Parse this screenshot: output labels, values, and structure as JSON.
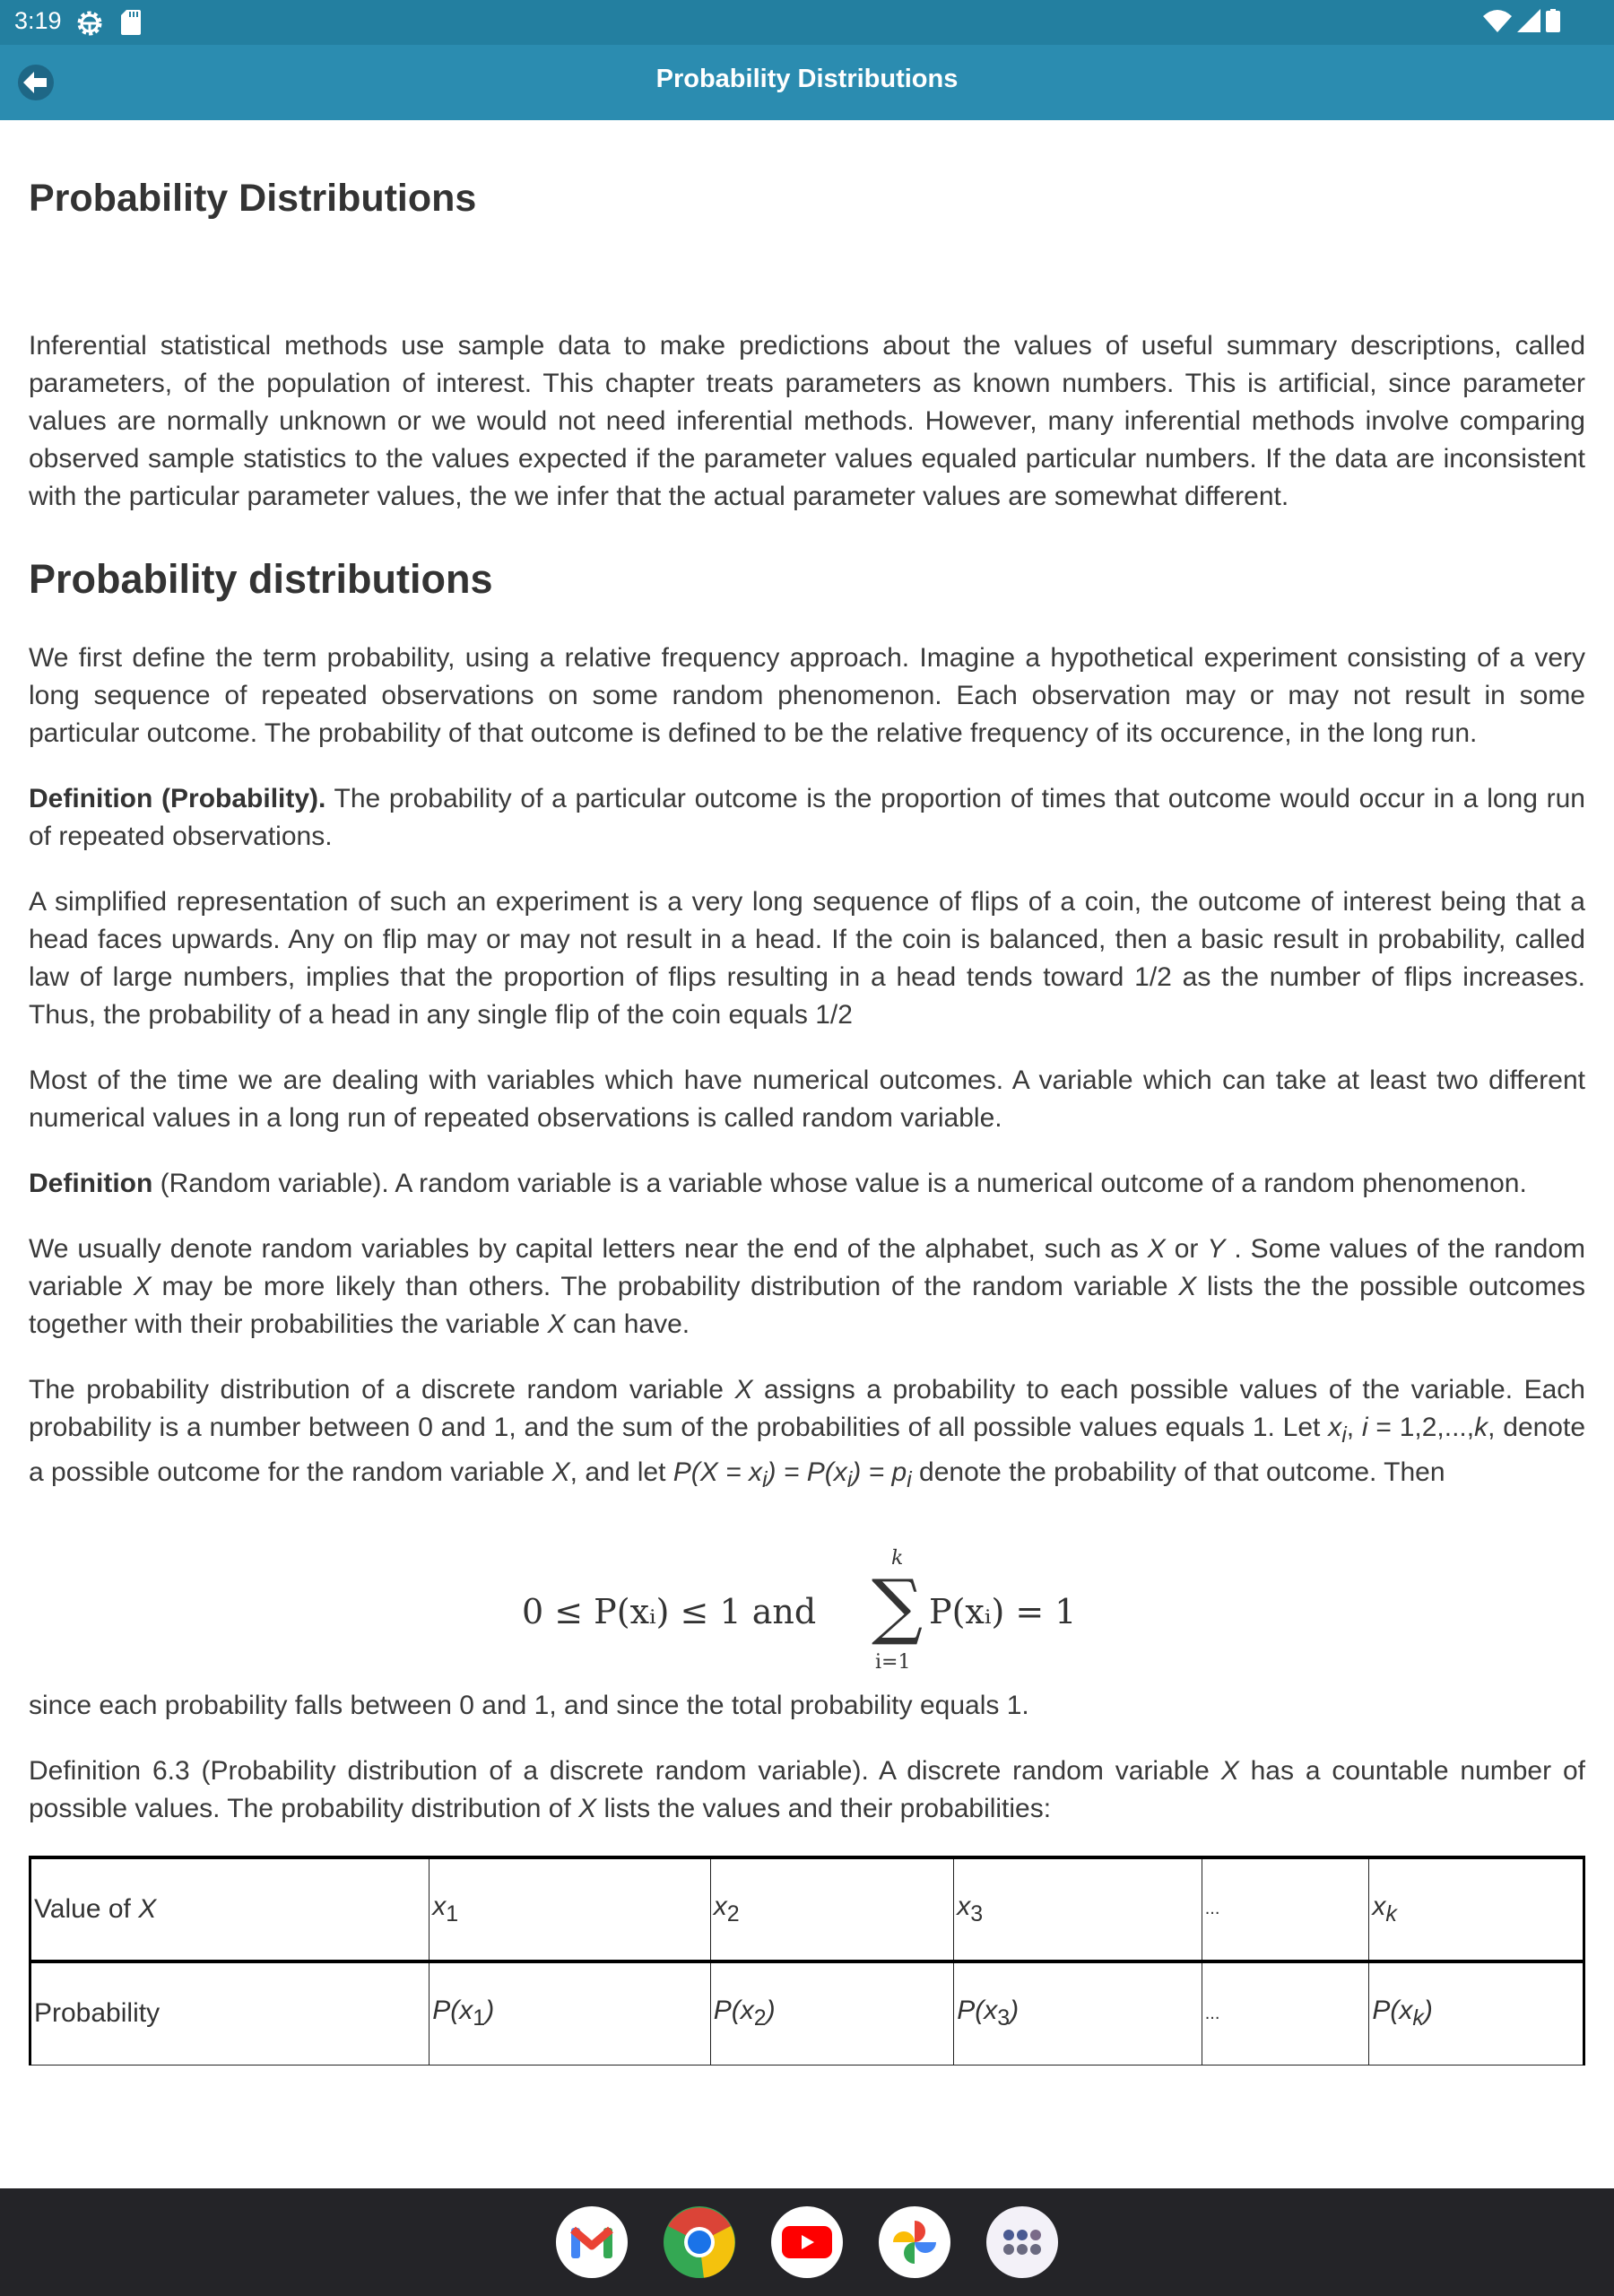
{
  "status_bar": {
    "time": "3:19",
    "icons": [
      "settings-gear-icon",
      "sd-card-icon",
      "wifi-icon",
      "cellular-signal-icon",
      "battery-icon"
    ]
  },
  "app_bar": {
    "title": "Probability Distributions",
    "back_icon": "arrow-left-icon"
  },
  "article": {
    "page_title": "Probability Distributions",
    "intro": "Inferential statistical methods use sample data to make predictions about the values of useful summary descriptions, called parameters, of the population of interest. This chapter treats parameters as known numbers. This is artificial, since parameter values are normally unknown or we would not need inferential methods. However, many inferential methods involve comparing observed sample statistics to the values expected if the parameter values equaled particular numbers. If the data are inconsistent with the particular parameter values, the we infer that the actual parameter values are somewhat different.",
    "section_title": "Probability distributions",
    "p1": "We first define the term probability, using a relative frequency approach. Imagine a hypothetical experiment consisting of a very long sequence of repeated observations on some random phenomenon. Each observation may or may not result in some particular outcome. The probability of that outcome is defined to be the relative frequency of its occurence, in the long run.",
    "def1_bold": "Definition  (Probability).",
    "def1_text": " The probability of a particular outcome is the proportion of times that outcome would occur in a long run of repeated observations.",
    "p2": "A simplified representation of such an experiment is a very long sequence of flips of a coin, the outcome of interest being that a head faces upwards. Any on flip may or may not result in a head. If the coin is balanced, then a basic result in probability, called law of large numbers, implies that the proportion of flips resulting in a head tends toward 1/2 as the number of flips increases. Thus, the probability of a head in any single flip of the coin equals 1/2",
    "p3": "Most of the time we are dealing with variables which have numerical outcomes. A variable which can take at least two different numerical values in a long run of repeated observations is called random variable.",
    "def2_bold": "Definition",
    "def2_text": " (Random variable). A random variable is a variable whose value is a numerical outcome of a random phenomenon.",
    "p4_a": "We usually denote random variables by capital letters near the end of the alphabet, such as ",
    "p4_X": "X",
    "p4_b": " or ",
    "p4_Y": "Y",
    "p4_c": " . Some values of the random variable ",
    "p4_d": " may be more likely than others. The probability distribution of the random variable ",
    "p4_e": " lists the the possible outcomes together with their probabilities the variable ",
    "p4_f": " can have.",
    "p5_a": "The probability distribution of a discrete random variable ",
    "p5_b": " assigns a probability to each possible values of the variable. Each probability is a number between 0 and 1, and the sum of the probabilities of all possible values equals 1. Let ",
    "p5_xi": "x",
    "p5_i": "i",
    "p5_c": ", ",
    "p5_d": " = 1,2,...,",
    "p5_k": "k",
    "p5_e": ", denote a possible outcome for the random variable ",
    "p5_f": ", and let ",
    "p5_eq": "P(X = x",
    "p5_g": ") = P(x",
    "p5_h": ") = p",
    "p5_j": " denote the probability of that outcome. Then",
    "formula": {
      "lhs": "0 ≤ P(xᵢ) ≤ 1   and",
      "sigma": "∑",
      "upper": "k",
      "lower": "i=1",
      "rhs": "P(xᵢ) = 1"
    },
    "p6": "since each probability falls between 0 and 1, and since the total probability equals 1.",
    "p7_a": "Definition 6.3 (Probability distribution of a discrete random variable). A discrete random variable ",
    "p7_b": " has a countable number of possible values. The probability distribution of ",
    "p7_c": " lists the values and their probabilities:",
    "table": {
      "rows": [
        {
          "label_a": "Value of ",
          "label_b": "X",
          "cells": [
            [
              "x",
              "1"
            ],
            [
              "x",
              "2"
            ],
            [
              "x",
              "3"
            ],
            [
              "...",
              ""
            ],
            [
              "x",
              "k"
            ]
          ]
        },
        {
          "label_a": "Probability",
          "label_b": "",
          "cells": [
            [
              "P(x",
              "1",
              ")"
            ],
            [
              "P(x",
              "2",
              ")"
            ],
            [
              "P(x",
              "3",
              ")"
            ],
            [
              "...",
              "",
              ""
            ],
            [
              "P(x",
              "k",
              ")"
            ]
          ]
        }
      ]
    }
  },
  "dock": {
    "apps": [
      "Gmail",
      "Chrome",
      "YouTube",
      "Photos",
      "App drawer"
    ]
  }
}
